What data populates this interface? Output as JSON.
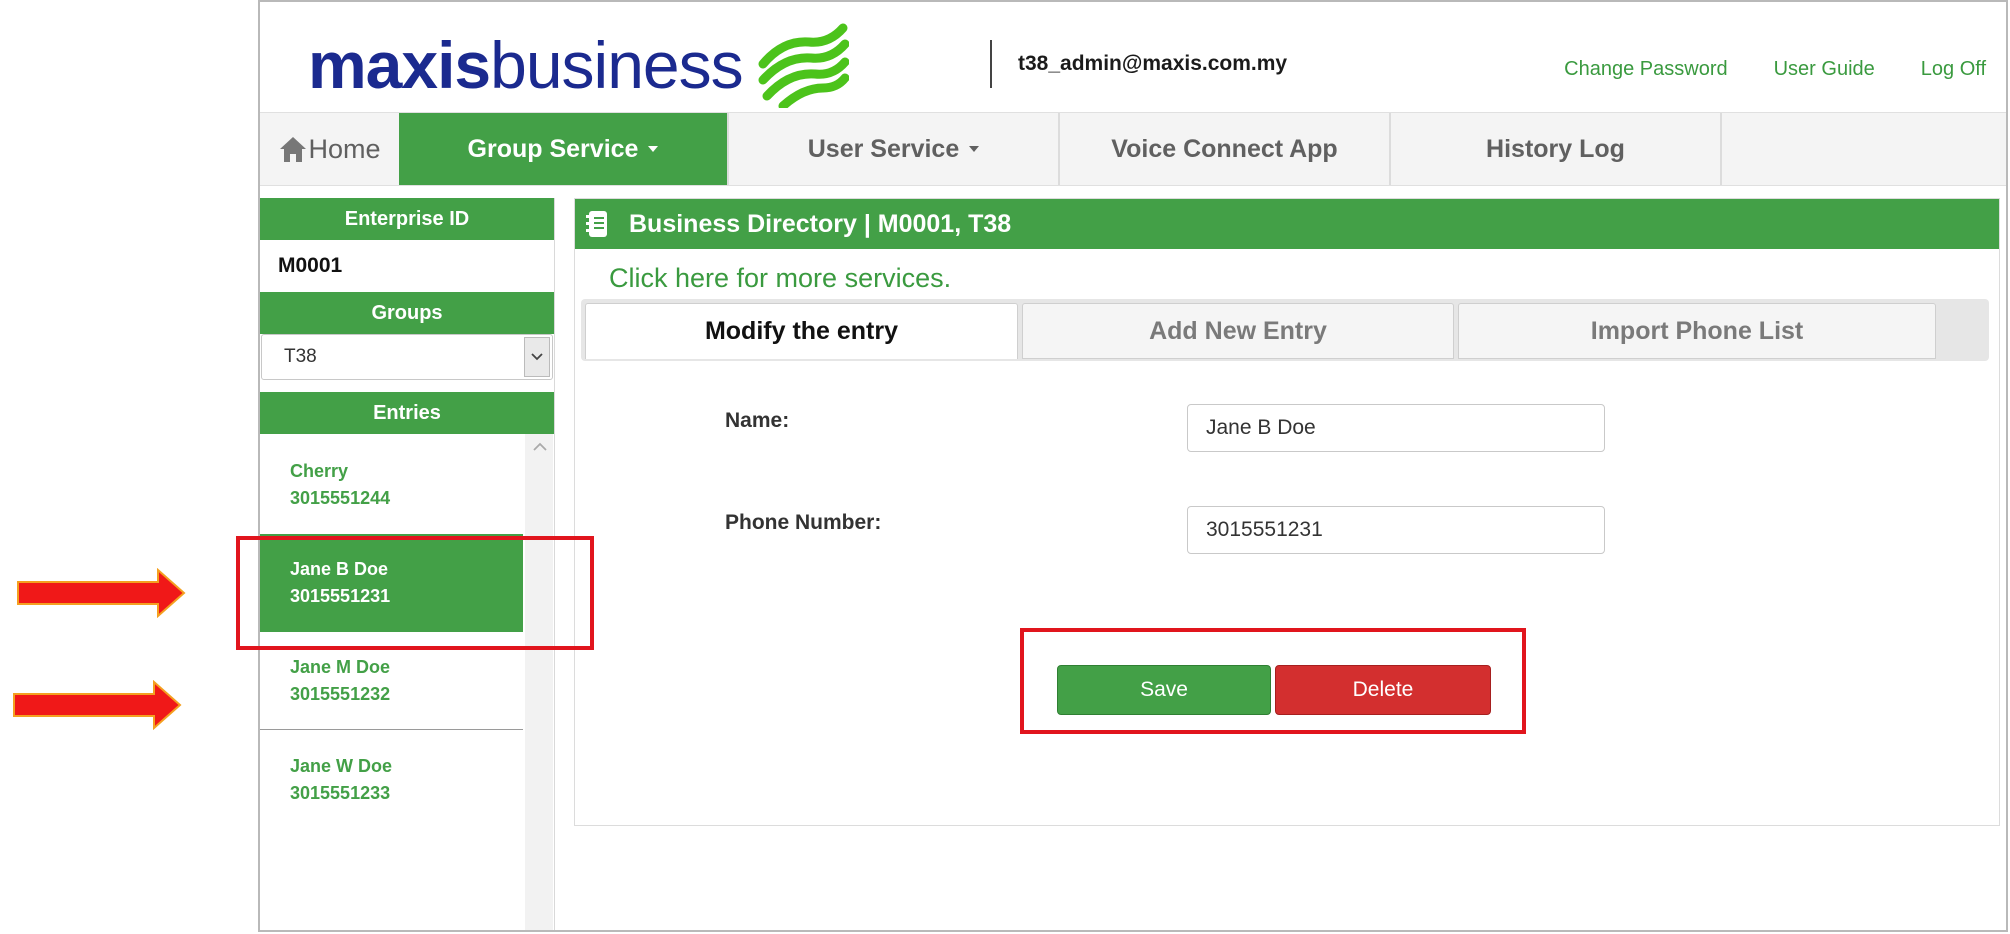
{
  "header": {
    "logo": {
      "part1": "maxis",
      "part2": "business",
      "mark": "maxis-swirl-logo"
    },
    "user_email": "t38_admin@maxis.com.my",
    "links": [
      "Change Password",
      "User Guide",
      "Log Off"
    ]
  },
  "nav": {
    "home": "Home",
    "items": [
      {
        "label": "Group Service",
        "dropdown": true,
        "active": true
      },
      {
        "label": "User Service",
        "dropdown": true,
        "active": false
      },
      {
        "label": "Voice Connect App",
        "dropdown": false,
        "active": false
      },
      {
        "label": "History Log",
        "dropdown": false,
        "active": false
      }
    ]
  },
  "sidebar": {
    "enterprise_header": "Enterprise ID",
    "enterprise_id": "M0001",
    "groups_header": "Groups",
    "group_selected": "T38",
    "entries_header": "Entries",
    "entries": [
      {
        "name": "Cherry",
        "phone": "3015551244"
      },
      {
        "name": "Jane B Doe",
        "phone": "3015551231",
        "selected": true
      },
      {
        "name": "Jane M Doe",
        "phone": "3015551232"
      },
      {
        "name": "Jane W Doe",
        "phone": "3015551233"
      }
    ]
  },
  "main": {
    "title": "Business Directory | M0001, T38",
    "more_link": "Click here for more services.",
    "tabs": [
      "Modify the entry",
      "Add New Entry",
      "Import Phone List"
    ],
    "form": {
      "name_label": "Name:",
      "name_value": "Jane B Doe",
      "phone_label": "Phone Number:",
      "phone_value": "3015551231"
    },
    "buttons": {
      "save": "Save",
      "delete": "Delete"
    }
  },
  "colors": {
    "brand_green": "#43a047",
    "brand_blue": "#1b2a8f",
    "delete_red": "#d32f2f",
    "annotation_red": "#e1151d",
    "arrow_orange": "#f4a020"
  }
}
